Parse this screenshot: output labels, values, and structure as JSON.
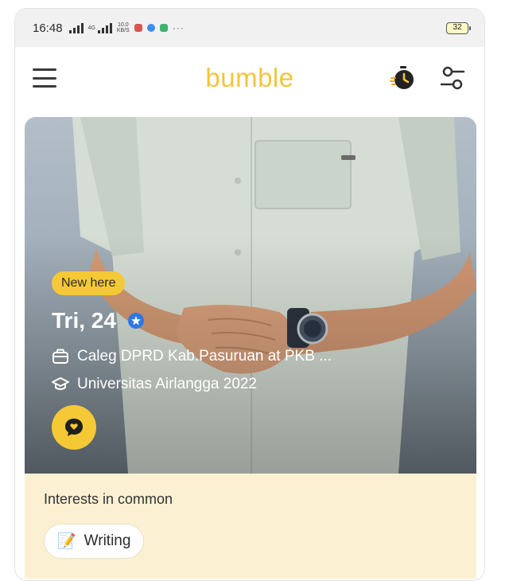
{
  "status_bar": {
    "time": "16:48",
    "net_label": "4G",
    "speed_value": "10.0",
    "speed_unit": "KB/S",
    "more": "···",
    "battery": "32"
  },
  "header": {
    "brand": "bumble",
    "menu_icon": "hamburger-icon",
    "spotlight_icon": "stopwatch-icon",
    "filter_icon": "sliders-icon"
  },
  "profile": {
    "badge": "New here",
    "name_age": "Tri, 24",
    "verified_icon": "verified-star-icon",
    "job": "Caleg DPRD Kab.Pasuruan at PKB ...",
    "education": "Universitas Airlangga 2022",
    "chat_icon": "chat-bubble-heart-icon"
  },
  "interests": {
    "title": "Interests in common",
    "items": [
      {
        "emoji": "📝",
        "label": "Writing"
      }
    ]
  },
  "colors": {
    "brand_yellow": "#f3c53a",
    "accent_yellow": "#f5c935",
    "interests_bg": "#fbf1d2",
    "verified_blue": "#2f78e3"
  }
}
